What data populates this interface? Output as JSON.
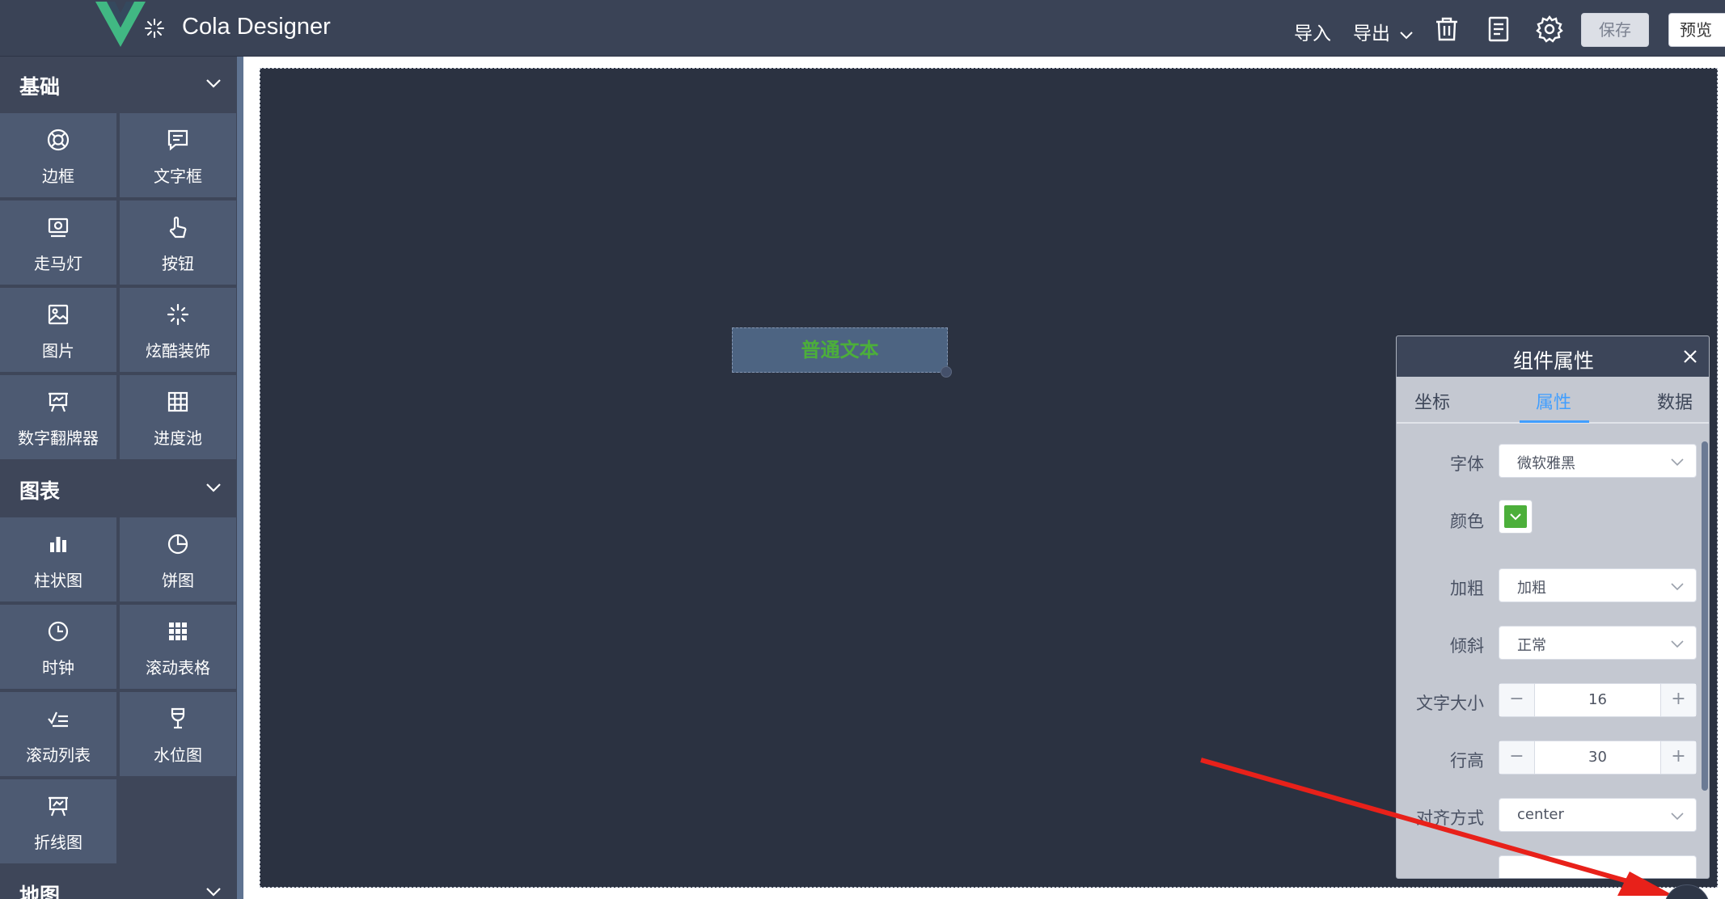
{
  "header": {
    "app_title": "Cola Designer",
    "import_label": "导入",
    "export_label": "导出",
    "save_label": "保存",
    "preview_label": "预览",
    "icons": [
      "vue-logo-icon",
      "spark-icon",
      "chevron-down-icon",
      "trash-icon",
      "document-icon",
      "gear-icon"
    ]
  },
  "sidebar": {
    "groups": [
      {
        "title": "基础",
        "items": [
          {
            "label": "边框",
            "icon": "lifebuoy-icon"
          },
          {
            "label": "文字框",
            "icon": "message-icon"
          },
          {
            "label": "走马灯",
            "icon": "carousel-icon"
          },
          {
            "label": "按钮",
            "icon": "pointer-hand-icon"
          },
          {
            "label": "图片",
            "icon": "image-icon"
          },
          {
            "label": "炫酷装饰",
            "icon": "sparkle-icon"
          },
          {
            "label": "数字翻牌器",
            "icon": "presentation-icon"
          },
          {
            "label": "进度池",
            "icon": "grid-icon"
          }
        ]
      },
      {
        "title": "图表",
        "items": [
          {
            "label": "柱状图",
            "icon": "bar-chart-icon"
          },
          {
            "label": "饼图",
            "icon": "pie-chart-icon"
          },
          {
            "label": "时钟",
            "icon": "clock-icon"
          },
          {
            "label": "滚动表格",
            "icon": "table-grid-icon"
          },
          {
            "label": "滚动列表",
            "icon": "list-check-icon"
          },
          {
            "label": "水位图",
            "icon": "goblet-icon"
          },
          {
            "label": "折线图",
            "icon": "line-chart-icon"
          }
        ]
      },
      {
        "title": "地图",
        "items": []
      }
    ]
  },
  "canvas": {
    "text_component": "普通文本"
  },
  "panel": {
    "title": "组件属性",
    "tabs": [
      {
        "label": "坐标",
        "active": false
      },
      {
        "label": "属性",
        "active": true
      },
      {
        "label": "数据",
        "active": false
      }
    ],
    "fields": {
      "font": {
        "label": "字体",
        "value": "微软雅黑"
      },
      "color": {
        "label": "颜色",
        "value": "#4caf3a"
      },
      "bold": {
        "label": "加粗",
        "value": "加粗"
      },
      "italic": {
        "label": "倾斜",
        "value": "正常"
      },
      "font_size": {
        "label": "文字大小",
        "value": "16",
        "minus": "−",
        "plus": "+"
      },
      "line_height": {
        "label": "行高",
        "value": "30",
        "minus": "−",
        "plus": "+"
      },
      "align": {
        "label": "对齐方式",
        "value": "center"
      }
    }
  },
  "colors": {
    "accent": "#409eff",
    "text_green": "#4caf3a",
    "annotation_arrow": "#e8211a"
  }
}
